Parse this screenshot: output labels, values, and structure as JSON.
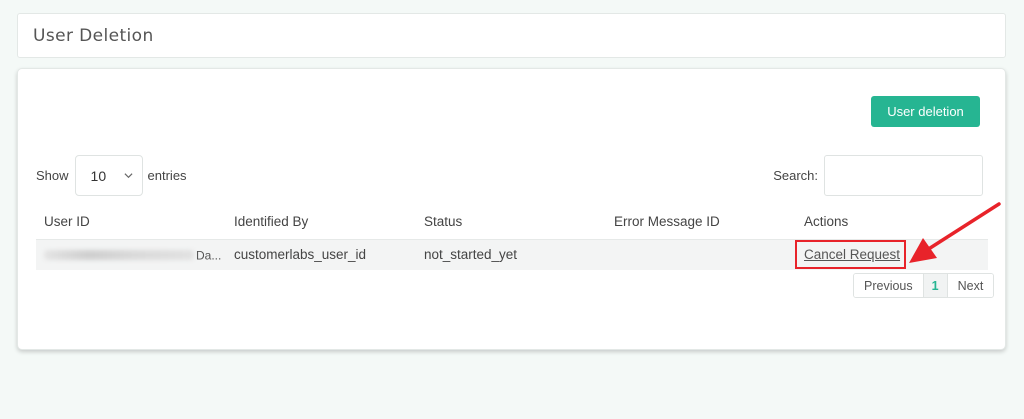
{
  "page": {
    "title": "User Deletion"
  },
  "toolbar": {
    "user_deletion_label": "User deletion"
  },
  "table_controls": {
    "show_label": "Show",
    "entries_value": "10",
    "entries_label": "entries",
    "search_label": "Search:",
    "search_value": ""
  },
  "table": {
    "columns": [
      "User ID",
      "Identified By",
      "Status",
      "Error Message ID",
      "Actions"
    ],
    "rows": [
      {
        "user_id_visible": "Da...",
        "identified_by": "customerlabs_user_id",
        "status": "not_started_yet",
        "error_message_id": "",
        "action_label": "Cancel Request"
      }
    ]
  },
  "pagination": {
    "previous": "Previous",
    "current": "1",
    "next": "Next"
  },
  "colors": {
    "accent": "#26b592",
    "annotation": "#e8232a",
    "background": "#f4f9f7"
  },
  "icons": {
    "select": "chevron-down-icon",
    "annotation": "red-arrow-icon"
  }
}
